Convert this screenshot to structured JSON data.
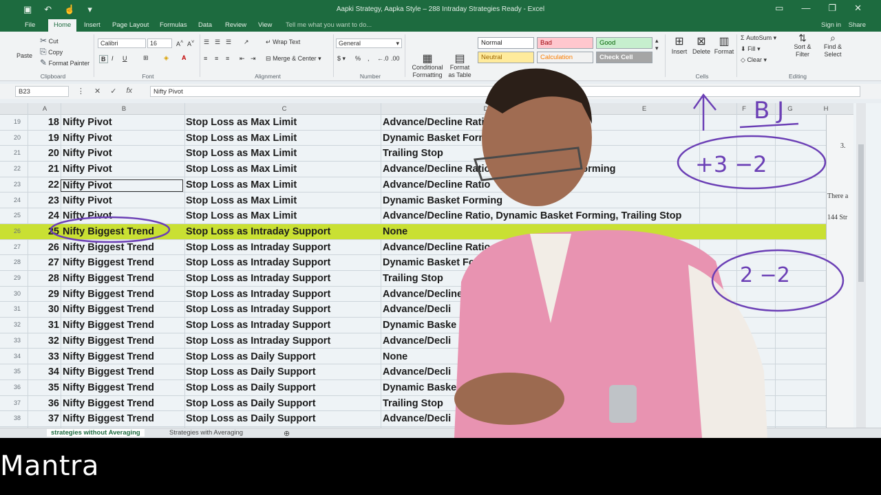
{
  "window": {
    "title": "Aapki Strategy, Aapka Style – 288 Intraday Strategies Ready - Excel",
    "sign_in": "Sign in",
    "share": "Share"
  },
  "ribbon_tabs": [
    "File",
    "Home",
    "Insert",
    "Page Layout",
    "Formulas",
    "Data",
    "Review",
    "View"
  ],
  "active_tab": "Home",
  "tell_me": "Tell me what you want to do...",
  "clipboard": {
    "paste": "Paste",
    "cut": "Cut",
    "copy": "Copy",
    "format_painter": "Format Painter",
    "label": "Clipboard"
  },
  "font": {
    "name": "Calibri",
    "size": "16",
    "label": "Font"
  },
  "alignment": {
    "wrap": "Wrap Text",
    "merge": "Merge & Center",
    "label": "Alignment"
  },
  "number": {
    "format": "General",
    "label": "Number"
  },
  "styles": {
    "conditional": "Conditional Formatting",
    "format_table": "Format as Table",
    "cells": [
      {
        "label": "Normal",
        "bg": "#ffffff",
        "fg": "#222222"
      },
      {
        "label": "Bad",
        "bg": "#ffc7ce",
        "fg": "#9c0006"
      },
      {
        "label": "Good",
        "bg": "#c6efce",
        "fg": "#006100"
      },
      {
        "label": "Neutral",
        "bg": "#ffeb9c",
        "fg": "#9c6500"
      },
      {
        "label": "Calculation",
        "bg": "#f2f2f2",
        "fg": "#fa7d00"
      },
      {
        "label": "Check Cell",
        "bg": "#a5a5a5",
        "fg": "#ffffff"
      }
    ],
    "label": "Styles"
  },
  "cells_group": {
    "insert": "Insert",
    "delete": "Delete",
    "format": "Format",
    "label": "Cells"
  },
  "editing": {
    "autosum": "AutoSum",
    "fill": "Fill",
    "clear": "Clear",
    "sort": "Sort & Filter",
    "find": "Find & Select",
    "label": "Editing"
  },
  "formula_bar": {
    "name_box": "B23",
    "content": "Nifty Pivot"
  },
  "columns": [
    "A",
    "B",
    "C",
    "D",
    "E",
    "F",
    "G",
    "H"
  ],
  "rows": [
    {
      "rn": "19",
      "a": "18",
      "b": "Nifty Pivot",
      "c": "Stop Loss as Max Limit",
      "d": "Advance/Decline Ratio"
    },
    {
      "rn": "20",
      "a": "19",
      "b": "Nifty Pivot",
      "c": "Stop Loss as Max Limit",
      "d": "Dynamic Basket Forming"
    },
    {
      "rn": "21",
      "a": "20",
      "b": "Nifty Pivot",
      "c": "Stop Loss as Max Limit",
      "d": "Trailing Stop"
    },
    {
      "rn": "22",
      "a": "21",
      "b": "Nifty Pivot",
      "c": "Stop Loss as Max Limit",
      "d": "Advance/Decline Ratio, Dynamic Basket Forming"
    },
    {
      "rn": "23",
      "a": "22",
      "b": "Nifty Pivot",
      "c": "Stop Loss as Max Limit",
      "d": "Advance/Decline Ratio"
    },
    {
      "rn": "24",
      "a": "23",
      "b": "Nifty Pivot",
      "c": "Stop Loss as Max Limit",
      "d": "Dynamic Basket Forming"
    },
    {
      "rn": "25",
      "a": "24",
      "b": "Nifty Pivot",
      "c": "Stop Loss as Max Limit",
      "d": "Advance/Decline Ratio, Dynamic Basket Forming, Trailing Stop"
    },
    {
      "rn": "26",
      "a": "25",
      "b": "Nifty Biggest Trend",
      "c": "Stop Loss as Intraday Support",
      "d": "None"
    },
    {
      "rn": "27",
      "a": "26",
      "b": "Nifty Biggest Trend",
      "c": "Stop Loss as Intraday Support",
      "d": "Advance/Decline Ratio"
    },
    {
      "rn": "28",
      "a": "27",
      "b": "Nifty Biggest Trend",
      "c": "Stop Loss as Intraday Support",
      "d": "Dynamic Basket Forming"
    },
    {
      "rn": "29",
      "a": "28",
      "b": "Nifty Biggest Trend",
      "c": "Stop Loss as Intraday Support",
      "d": "Trailing Stop"
    },
    {
      "rn": "30",
      "a": "29",
      "b": "Nifty Biggest Trend",
      "c": "Stop Loss as Intraday Support",
      "d": "Advance/Decline"
    },
    {
      "rn": "31",
      "a": "30",
      "b": "Nifty Biggest Trend",
      "c": "Stop Loss as Intraday Support",
      "d": "Advance/Decli"
    },
    {
      "rn": "32",
      "a": "31",
      "b": "Nifty Biggest Trend",
      "c": "Stop Loss as Intraday Support",
      "d": "Dynamic Baske"
    },
    {
      "rn": "33",
      "a": "32",
      "b": "Nifty Biggest Trend",
      "c": "Stop Loss as Intraday Support",
      "d": "Advance/Decli"
    },
    {
      "rn": "34",
      "a": "33",
      "b": "Nifty Biggest Trend",
      "c": "Stop Loss as Daily Support",
      "d": "None"
    },
    {
      "rn": "35",
      "a": "34",
      "b": "Nifty Biggest Trend",
      "c": "Stop Loss as Daily Support",
      "d": "Advance/Decli"
    },
    {
      "rn": "36",
      "a": "35",
      "b": "Nifty Biggest Trend",
      "c": "Stop Loss as Daily Support",
      "d": "Dynamic Baske"
    },
    {
      "rn": "37",
      "a": "36",
      "b": "Nifty Biggest Trend",
      "c": "Stop Loss as Daily Support",
      "d": "Trailing Stop"
    },
    {
      "rn": "38",
      "a": "37",
      "b": "Nifty Biggest Trend",
      "c": "Stop Loss as Daily Support",
      "d": "Advance/Decli"
    }
  ],
  "highlight_row_index": 7,
  "highlight_color": "#c9e033",
  "h_column_text": [
    "3.",
    "There a",
    "144 Str"
  ],
  "annotations": {
    "top_label": "B J",
    "score_1": "+3 −2",
    "score_2": "2 −2"
  },
  "sheet_tabs": [
    "strategies without Averaging",
    "Strategies with Averaging"
  ],
  "active_sheet": "strategies without Averaging",
  "caption": "Mantra"
}
